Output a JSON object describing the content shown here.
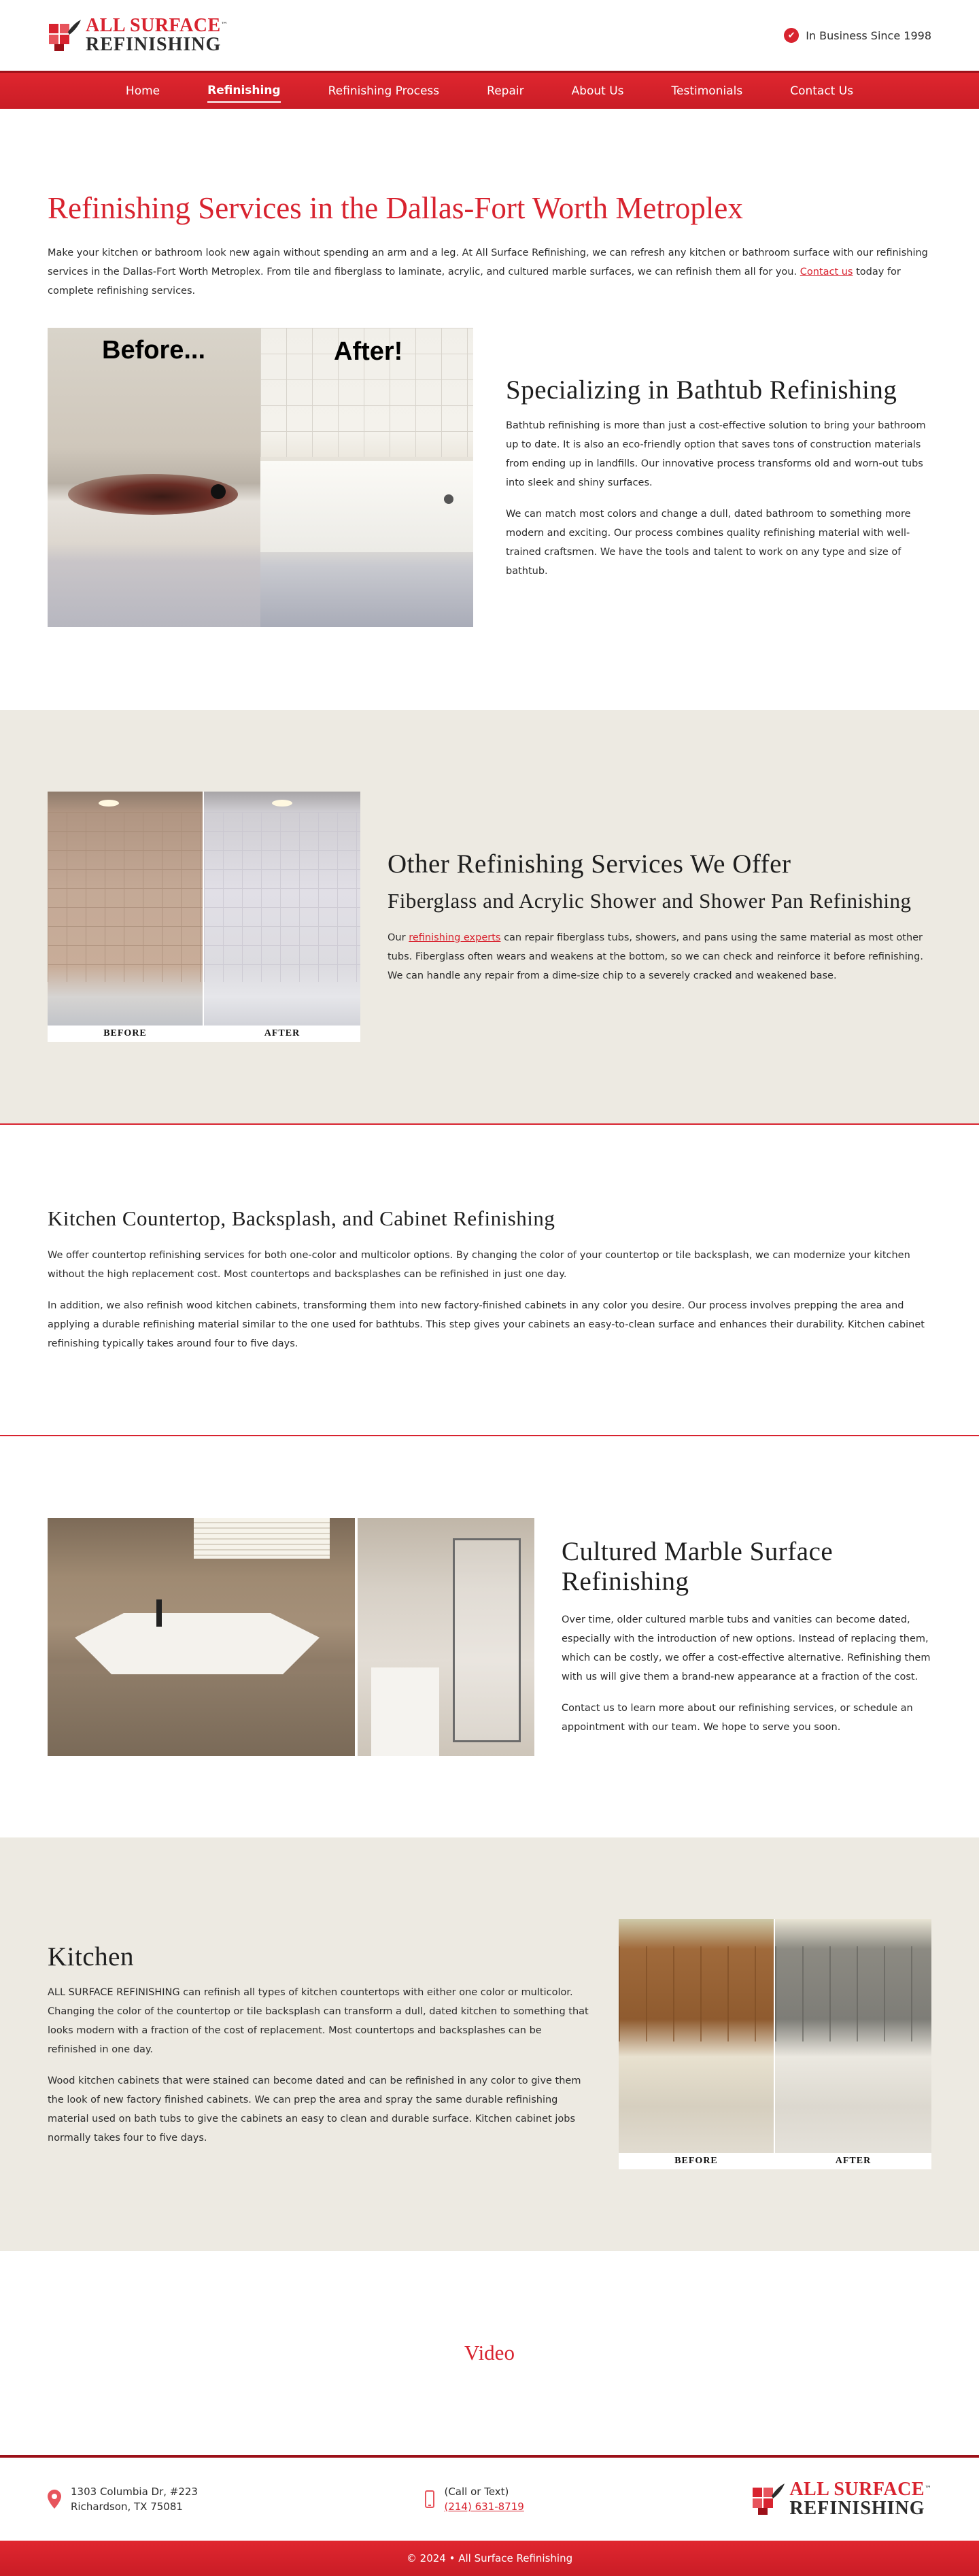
{
  "header": {
    "logo_line1": "ALL SURFACE",
    "logo_tm": "™",
    "logo_line2": "REFINISHING",
    "since": "In Business Since 1998"
  },
  "nav": {
    "items": [
      "Home",
      "Refinishing",
      "Refinishing Process",
      "Repair",
      "About Us",
      "Testimonials",
      "Contact Us"
    ],
    "active": "Refinishing"
  },
  "intro": {
    "title": "Refinishing Services in the Dallas-Fort Worth Metroplex",
    "text_before_link": "Make your kitchen or bathroom look new again without spending an arm and a leg. At All Surface Refinishing, we can refresh any kitchen or bathroom surface with our refinishing services in the Dallas-Fort Worth Metroplex. From tile and fiberglass to laminate, acrylic, and cultured marble surfaces, we can refinish them all for you.",
    "link": "Contact us",
    "text_after_link": "today for complete refinishing services."
  },
  "bathtub": {
    "before_label": "Before...",
    "after_label": "After!",
    "title": "Specializing in Bathtub Refinishing",
    "p1": "Bathtub refinishing is more than just a cost-effective solution to bring your bathroom up to date. It is also an eco-friendly option that saves tons of construction materials from ending up in landfills. Our innovative process transforms old and worn-out tubs into sleek and shiny surfaces.",
    "p2": "We can match most colors and change a dull, dated bathroom to something more modern and exciting. Our process combines quality refinishing material with well-trained craftsmen. We have the tools and talent to work on any type and size of bathtub."
  },
  "other": {
    "before_label": "BEFORE",
    "after_label": "AFTER",
    "title": "Other Refinishing Services We Offer",
    "subtitle": "Fiberglass and Acrylic Shower and Shower Pan Refinishing",
    "text_before_link": "Our",
    "link": "refinishing experts",
    "text_after_link": "can repair fiberglass tubs, showers, and pans using the same material as most other tubs. Fiberglass often wears and weakens at the bottom, so we can check and reinforce it before refinishing. We can handle any repair from a dime-size chip to a severely cracked and weakened base."
  },
  "counter": {
    "title": "Kitchen Countertop, Backsplash, and Cabinet Refinishing",
    "p1": "We offer countertop refinishing services for both one-color and multicolor options. By changing the color of your countertop or tile backsplash, we can modernize your kitchen without the high replacement cost. Most countertops and backsplashes can be refinished in just one day.",
    "p2": "In addition, we also refinish wood kitchen cabinets, transforming them into new factory-finished cabinets in any color you desire. Our process involves prepping the area and applying a durable refinishing material similar to the one used for bathtubs. This step gives your cabinets an easy-to-clean surface and enhances their durability. Kitchen cabinet refinishing typically takes around four to five days."
  },
  "marble": {
    "title": "Cultured Marble Surface Refinishing",
    "p1": "Over time, older cultured marble tubs and vanities can become dated, especially with the introduction of new options. Instead of replacing them, which can be costly, we offer a cost-effective alternative. Refinishing them with us will give them a brand-new appearance at a fraction of the cost.",
    "p2": "Contact us to learn more about our refinishing services, or schedule an appointment with our team. We hope to serve you soon."
  },
  "kitchen": {
    "title": "Kitchen",
    "before_label": "BEFORE",
    "after_label": "AFTER",
    "p1": "ALL SURFACE REFINISHING can refinish all types of kitchen countertops with either one color or multicolor. Changing the color of the countertop or tile backsplash can transform a dull, dated kitchen to something that looks modern with a fraction of the cost of replacement. Most countertops and backsplashes can be refinished in one day.",
    "p2": "Wood kitchen cabinets that were stained can become dated and can be refinished in any color to give them the look of new factory finished cabinets. We can prep the area and spray the same durable refinishing material used on bath tubs to give the cabinets an easy to clean and durable surface. Kitchen cabinet jobs normally takes four to five days."
  },
  "video": {
    "title": "Video"
  },
  "footer": {
    "address_line1": "1303 Columbia Dr, #223",
    "address_line2": "Richardson, TX 75081",
    "phone_label": "(Call or Text)",
    "phone": "(214) 631-8719",
    "copyright": "© 2024 • All Surface Refinishing"
  },
  "colors": {
    "brand_red": "#d8232f",
    "beige": "#edeae2",
    "text": "#2b2b2b"
  }
}
